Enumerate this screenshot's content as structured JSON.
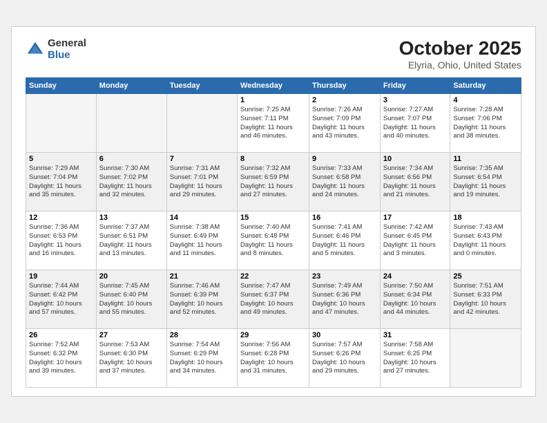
{
  "header": {
    "logo_general": "General",
    "logo_blue": "Blue",
    "month_title": "October 2025",
    "location": "Elyria, Ohio, United States"
  },
  "weekdays": [
    "Sunday",
    "Monday",
    "Tuesday",
    "Wednesday",
    "Thursday",
    "Friday",
    "Saturday"
  ],
  "weeks": [
    [
      {
        "day": "",
        "info": ""
      },
      {
        "day": "",
        "info": ""
      },
      {
        "day": "",
        "info": ""
      },
      {
        "day": "1",
        "info": "Sunrise: 7:25 AM\nSunset: 7:11 PM\nDaylight: 11 hours\nand 46 minutes."
      },
      {
        "day": "2",
        "info": "Sunrise: 7:26 AM\nSunset: 7:09 PM\nDaylight: 11 hours\nand 43 minutes."
      },
      {
        "day": "3",
        "info": "Sunrise: 7:27 AM\nSunset: 7:07 PM\nDaylight: 11 hours\nand 40 minutes."
      },
      {
        "day": "4",
        "info": "Sunrise: 7:28 AM\nSunset: 7:06 PM\nDaylight: 11 hours\nand 38 minutes."
      }
    ],
    [
      {
        "day": "5",
        "info": "Sunrise: 7:29 AM\nSunset: 7:04 PM\nDaylight: 11 hours\nand 35 minutes."
      },
      {
        "day": "6",
        "info": "Sunrise: 7:30 AM\nSunset: 7:02 PM\nDaylight: 11 hours\nand 32 minutes."
      },
      {
        "day": "7",
        "info": "Sunrise: 7:31 AM\nSunset: 7:01 PM\nDaylight: 11 hours\nand 29 minutes."
      },
      {
        "day": "8",
        "info": "Sunrise: 7:32 AM\nSunset: 6:59 PM\nDaylight: 11 hours\nand 27 minutes."
      },
      {
        "day": "9",
        "info": "Sunrise: 7:33 AM\nSunset: 6:58 PM\nDaylight: 11 hours\nand 24 minutes."
      },
      {
        "day": "10",
        "info": "Sunrise: 7:34 AM\nSunset: 6:56 PM\nDaylight: 11 hours\nand 21 minutes."
      },
      {
        "day": "11",
        "info": "Sunrise: 7:35 AM\nSunset: 6:54 PM\nDaylight: 11 hours\nand 19 minutes."
      }
    ],
    [
      {
        "day": "12",
        "info": "Sunrise: 7:36 AM\nSunset: 6:53 PM\nDaylight: 11 hours\nand 16 minutes."
      },
      {
        "day": "13",
        "info": "Sunrise: 7:37 AM\nSunset: 6:51 PM\nDaylight: 11 hours\nand 13 minutes."
      },
      {
        "day": "14",
        "info": "Sunrise: 7:38 AM\nSunset: 6:49 PM\nDaylight: 11 hours\nand 11 minutes."
      },
      {
        "day": "15",
        "info": "Sunrise: 7:40 AM\nSunset: 6:48 PM\nDaylight: 11 hours\nand 8 minutes."
      },
      {
        "day": "16",
        "info": "Sunrise: 7:41 AM\nSunset: 6:46 PM\nDaylight: 11 hours\nand 5 minutes."
      },
      {
        "day": "17",
        "info": "Sunrise: 7:42 AM\nSunset: 6:45 PM\nDaylight: 11 hours\nand 3 minutes."
      },
      {
        "day": "18",
        "info": "Sunrise: 7:43 AM\nSunset: 6:43 PM\nDaylight: 11 hours\nand 0 minutes."
      }
    ],
    [
      {
        "day": "19",
        "info": "Sunrise: 7:44 AM\nSunset: 6:42 PM\nDaylight: 10 hours\nand 57 minutes."
      },
      {
        "day": "20",
        "info": "Sunrise: 7:45 AM\nSunset: 6:40 PM\nDaylight: 10 hours\nand 55 minutes."
      },
      {
        "day": "21",
        "info": "Sunrise: 7:46 AM\nSunset: 6:39 PM\nDaylight: 10 hours\nand 52 minutes."
      },
      {
        "day": "22",
        "info": "Sunrise: 7:47 AM\nSunset: 6:37 PM\nDaylight: 10 hours\nand 49 minutes."
      },
      {
        "day": "23",
        "info": "Sunrise: 7:49 AM\nSunset: 6:36 PM\nDaylight: 10 hours\nand 47 minutes."
      },
      {
        "day": "24",
        "info": "Sunrise: 7:50 AM\nSunset: 6:34 PM\nDaylight: 10 hours\nand 44 minutes."
      },
      {
        "day": "25",
        "info": "Sunrise: 7:51 AM\nSunset: 6:33 PM\nDaylight: 10 hours\nand 42 minutes."
      }
    ],
    [
      {
        "day": "26",
        "info": "Sunrise: 7:52 AM\nSunset: 6:32 PM\nDaylight: 10 hours\nand 39 minutes."
      },
      {
        "day": "27",
        "info": "Sunrise: 7:53 AM\nSunset: 6:30 PM\nDaylight: 10 hours\nand 37 minutes."
      },
      {
        "day": "28",
        "info": "Sunrise: 7:54 AM\nSunset: 6:29 PM\nDaylight: 10 hours\nand 34 minutes."
      },
      {
        "day": "29",
        "info": "Sunrise: 7:56 AM\nSunset: 6:28 PM\nDaylight: 10 hours\nand 31 minutes."
      },
      {
        "day": "30",
        "info": "Sunrise: 7:57 AM\nSunset: 6:26 PM\nDaylight: 10 hours\nand 29 minutes."
      },
      {
        "day": "31",
        "info": "Sunrise: 7:58 AM\nSunset: 6:25 PM\nDaylight: 10 hours\nand 27 minutes."
      },
      {
        "day": "",
        "info": ""
      }
    ]
  ]
}
